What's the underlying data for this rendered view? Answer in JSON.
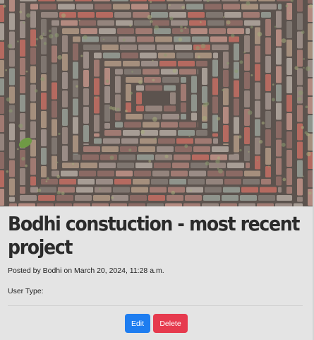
{
  "post": {
    "title": "Bodhi constuction - most recent project",
    "meta": "Posted by Bodhi on March 20, 2024, 11:28 a.m.",
    "user_type_label": "User Type:",
    "user_type_value": "",
    "image_alt": "Brick pavement laid in concentric rectangular pattern"
  },
  "actions": {
    "edit_label": "Edit",
    "delete_label": "Delete"
  },
  "colors": {
    "edit": "#1e7df0",
    "delete": "#e63a4e",
    "card_bg": "#e4e4e4"
  }
}
